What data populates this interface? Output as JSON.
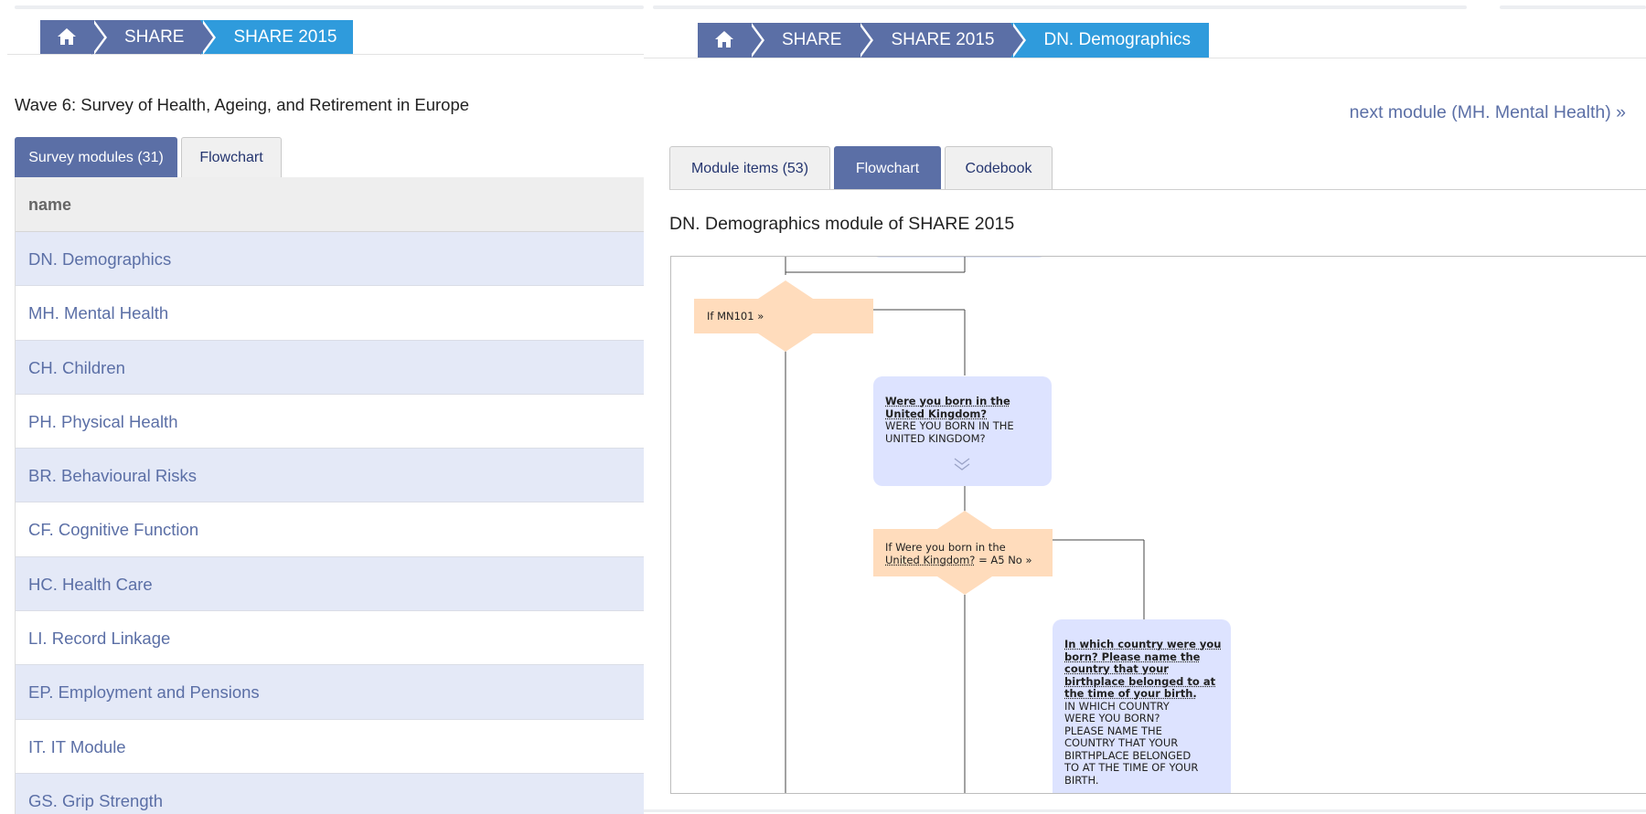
{
  "left": {
    "breadcrumb": [
      "SHARE",
      "SHARE 2015"
    ],
    "wave_title": "Wave 6: Survey of Health, Ageing, and Retirement in Europe",
    "tabs": [
      "Survey modules (31)",
      "Flowchart"
    ],
    "table_header": "name",
    "rows": [
      "DN. Demographics",
      "MH. Mental Health",
      "CH. Children",
      "PH. Physical Health",
      "BR. Behavioural Risks",
      "CF. Cognitive Function",
      "HC. Health Care",
      "LI. Record Linkage",
      "EP. Employment and Pensions",
      "IT. IT Module",
      "GS. Grip Strength"
    ]
  },
  "right": {
    "breadcrumb": [
      "SHARE",
      "SHARE 2015",
      "DN. Demographics"
    ],
    "next_link": "next module (MH. Mental Health) »",
    "tabs": [
      "Module items (53)",
      "Flowchart",
      "Codebook"
    ],
    "module_title": "DN. Demographics module of SHARE 2015",
    "flow": {
      "cond1": "If MN101 »",
      "q1_title": "Were you born in the United Kingdom?",
      "q1_line1": "Were you born in the",
      "q1_line2": "United Kingdom?",
      "q1_text_1": "WERE YOU BORN IN THE",
      "q1_text_2": "UNITED KINGDOM?",
      "cond2_line1": "If Were you born in the",
      "cond2_link": "United Kingdom?",
      "cond2_rest": " = A5 No »",
      "q2_lines": [
        "In which country were you",
        "born? Please name the",
        "country that your",
        "birthplace belonged to at",
        "the time of your birth."
      ],
      "q2_text": [
        "IN WHICH COUNTRY",
        "WERE YOU BORN?",
        "PLEASE NAME THE",
        "COUNTRY THAT YOUR",
        "BIRTHPLACE BELONGED",
        "TO AT THE TIME OF YOUR",
        "BIRTH."
      ]
    }
  },
  "colors": {
    "crumb": "#5b6fa6",
    "crumb_active": "#2f9bdc",
    "row_alt": "#e4e9f7",
    "condition_node": "#ffdcbc",
    "question_node": "#dde3ff"
  }
}
